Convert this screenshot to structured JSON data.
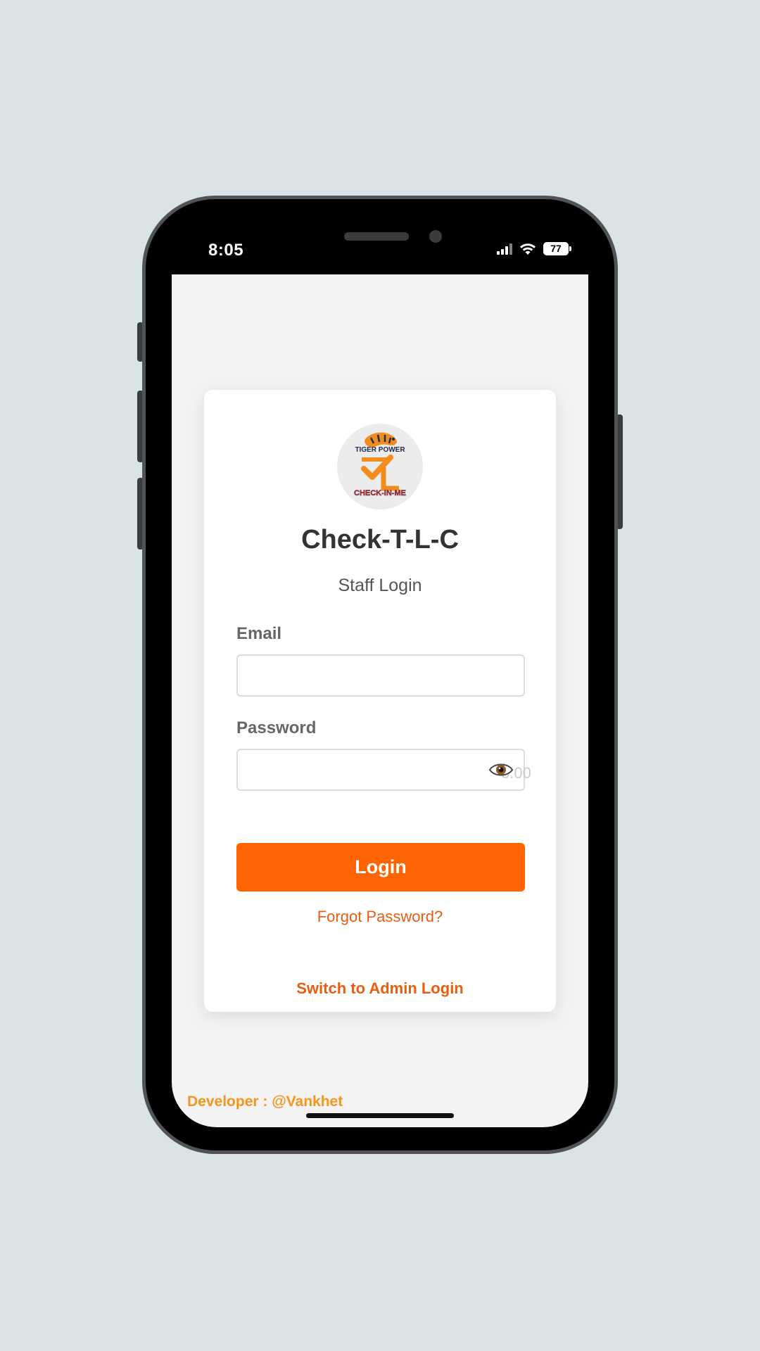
{
  "status_bar": {
    "time": "8:05",
    "battery": "77",
    "icons": [
      "signal-icon",
      "wifi-icon",
      "battery-icon"
    ]
  },
  "logo": {
    "top_text": "TIGER POWER",
    "bottom_text": "CHECK-IN-ME"
  },
  "login": {
    "title": "Check-T-L-C",
    "subtitle": "Staff Login",
    "email_label": "Email",
    "email_value": "",
    "password_label": "Password",
    "password_value": "",
    "password_overlay_text": "0:00",
    "show_password_icon": "eye-icon",
    "login_button": "Login",
    "forgot_password": "Forgot Password?",
    "switch_login": "Switch to Admin Login"
  },
  "footer": {
    "developer": "Developer : @Vankhet"
  },
  "colors": {
    "accent": "#ff6404",
    "link": "#e85d10",
    "developer": "#f5951e",
    "background": "#f3f3f3"
  }
}
